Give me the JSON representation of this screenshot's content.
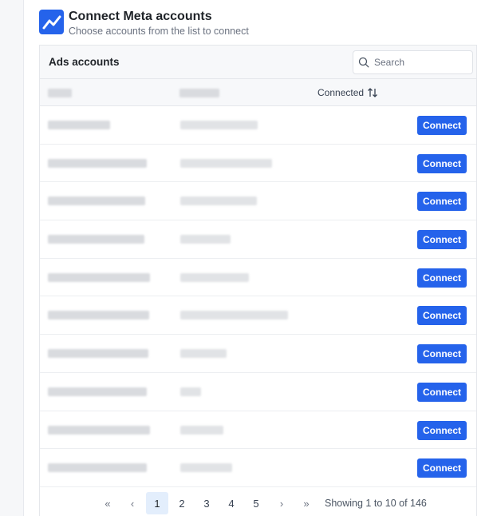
{
  "header": {
    "title": "Connect Meta accounts",
    "subtitle": "Choose accounts from the list to connect",
    "logo_icon": "chart-line-icon",
    "accent_color": "#2563eb"
  },
  "panel": {
    "title": "Ads accounts",
    "search": {
      "placeholder": "Search",
      "value": ""
    },
    "columns": {
      "connected_label": "Connected"
    }
  },
  "rows": [
    {
      "button_label": "Connect"
    },
    {
      "button_label": "Connect"
    },
    {
      "button_label": "Connect"
    },
    {
      "button_label": "Connect"
    },
    {
      "button_label": "Connect"
    },
    {
      "button_label": "Connect"
    },
    {
      "button_label": "Connect"
    },
    {
      "button_label": "Connect"
    },
    {
      "button_label": "Connect"
    },
    {
      "button_label": "Connect"
    }
  ],
  "pagination": {
    "first": "«",
    "prev": "‹",
    "pages": [
      "1",
      "2",
      "3",
      "4",
      "5"
    ],
    "current": "1",
    "next": "›",
    "last": "»",
    "showing": "Showing 1 to 10 of 146"
  }
}
